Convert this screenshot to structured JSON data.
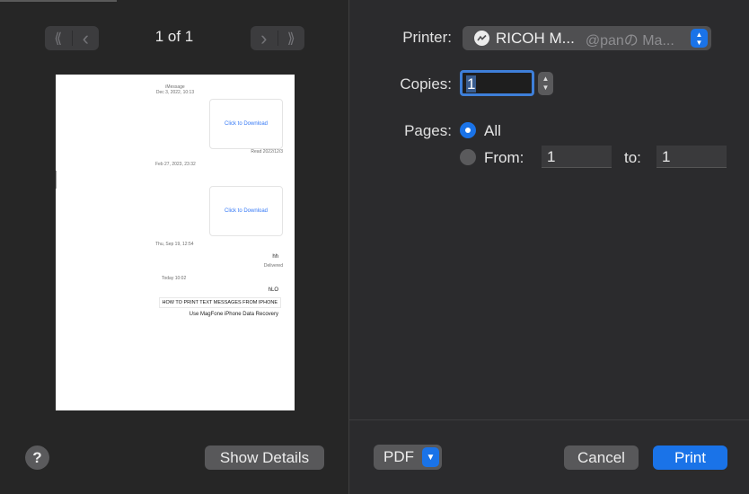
{
  "preview_nav": {
    "first_icon": "⟪",
    "prev_icon": "‹",
    "next_icon": "›",
    "last_icon": "⟫",
    "page_indicator": "1 of 1"
  },
  "preview_page": {
    "service": "iMessage",
    "first_date": "Dec 3, 2022, 10:13",
    "attachment_1": "Click to Download",
    "read_receipt": "Read 2022/12/3",
    "second_date": "Feb 27, 2023, 23:32",
    "attachment_2": "Click to Download",
    "third_date": "Thu, Sep 19, 12:54",
    "message_hh": "hh",
    "delivered": "Delivered",
    "fourth_date": "Today 10:02",
    "message_hlo": "hLO",
    "message_how_to": "HOW TO PRINT TEXT MESSAGES FROM IPHONE",
    "message_magfone": "Use MagFone iPhone Data Recovery"
  },
  "bottom_left": {
    "help_label": "?",
    "show_details_label": "Show Details"
  },
  "printer": {
    "label": "Printer:",
    "name": "RICOH M...",
    "host": "@panの Ma...",
    "icon": "messenger-icon"
  },
  "copies": {
    "label": "Copies:",
    "value": "1"
  },
  "pages": {
    "label": "Pages:",
    "all_label": "All",
    "from_label": "From:",
    "from_value": "1",
    "to_label": "to:",
    "to_value": "1",
    "selected": "All"
  },
  "bottom_right": {
    "pdf_label": "PDF",
    "cancel_label": "Cancel",
    "print_label": "Print"
  },
  "colors": {
    "accent": "#1a73e8",
    "background": "#2b2b2d"
  }
}
